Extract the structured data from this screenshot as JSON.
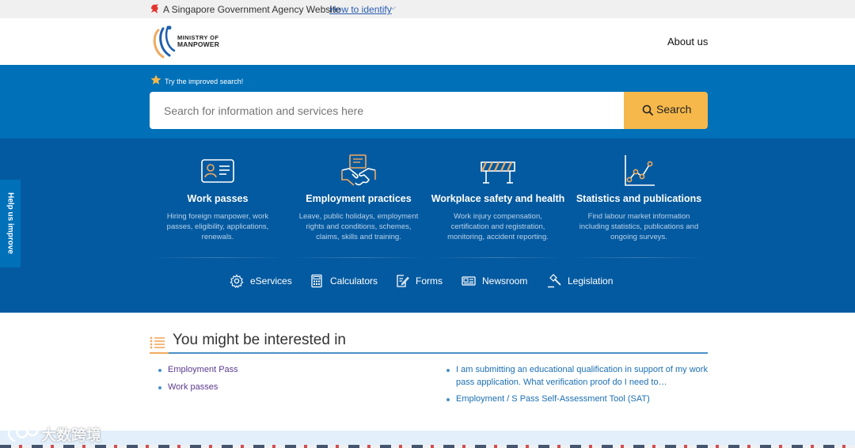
{
  "masthead": {
    "text": "A Singapore Government Agency Website",
    "link": "How to identify"
  },
  "header": {
    "logo_line1": "MINISTRY OF",
    "logo_line2": "MANPOWER",
    "about": "About us"
  },
  "search": {
    "tip": "Try the improved search!",
    "placeholder": "Search for information and services here",
    "button": "Search"
  },
  "categories": [
    {
      "icon": "id-card-icon",
      "title": "Work passes",
      "description": "Hiring foreign manpower, work passes, eligibility, applications, renewals."
    },
    {
      "icon": "handshake-icon",
      "title": "Employment practices",
      "description": "Leave, public holidays, employment rights and conditions, schemes, claims, skills and training."
    },
    {
      "icon": "barrier-icon",
      "title": "Workplace safety and health",
      "description": "Work injury compensation, certification and registration, monitoring, accident reporting."
    },
    {
      "icon": "line-chart-icon",
      "title": "Statistics and publications",
      "description": "Find labour market information including statistics, publications and ongoing surveys."
    }
  ],
  "quicklinks": [
    {
      "icon": "gear-icon",
      "label": "eServices"
    },
    {
      "icon": "calculator-icon",
      "label": "Calculators"
    },
    {
      "icon": "form-icon",
      "label": "Forms"
    },
    {
      "icon": "newspaper-icon",
      "label": "Newsroom"
    },
    {
      "icon": "gavel-icon",
      "label": "Legislation"
    }
  ],
  "feedback": "Help us improve",
  "interested": {
    "title": "You might be interested in",
    "left": [
      "Employment Pass",
      "Work passes"
    ],
    "right": [
      "I am submitting an educational qualification in support of my work pass application. What verification proof do I need to…",
      "Employment / S Pass Self-Assessment Tool (SAT)"
    ]
  },
  "watermark": "大数跨境",
  "colors": {
    "search_band": "#0070b8",
    "category_band": "#045aa0",
    "search_button": "#f6b84b",
    "icon_accent": "#f0a95f"
  }
}
